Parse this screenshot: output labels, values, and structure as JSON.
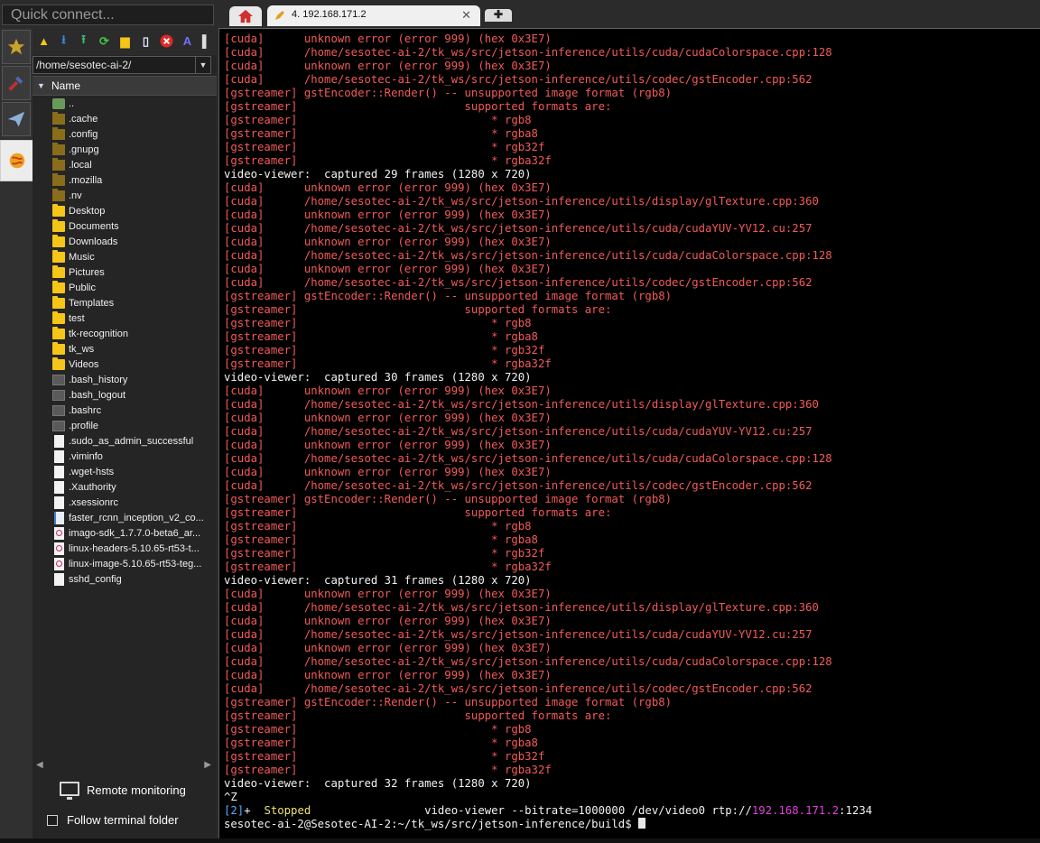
{
  "quick_connect": {
    "placeholder": "Quick connect..."
  },
  "tabs": {
    "home_icon": "home-icon",
    "session_label": "4. 192.168.171.2",
    "close_glyph": "✕",
    "new_tab_glyph": "✚"
  },
  "side_tabs": [
    "star-icon",
    "tools-icon",
    "send-icon",
    "sftp-icon"
  ],
  "file_panel": {
    "path": "/home/sesotec-ai-2/",
    "column_name": "Name",
    "items": [
      {
        "name": "..",
        "type": "up"
      },
      {
        "name": ".cache",
        "type": "hfolder"
      },
      {
        "name": ".config",
        "type": "hfolder"
      },
      {
        "name": ".gnupg",
        "type": "hfolder"
      },
      {
        "name": ".local",
        "type": "hfolder"
      },
      {
        "name": ".mozilla",
        "type": "hfolder"
      },
      {
        "name": ".nv",
        "type": "hfolder"
      },
      {
        "name": "Desktop",
        "type": "folder"
      },
      {
        "name": "Documents",
        "type": "folder"
      },
      {
        "name": "Downloads",
        "type": "folder"
      },
      {
        "name": "Music",
        "type": "folder"
      },
      {
        "name": "Pictures",
        "type": "folder"
      },
      {
        "name": "Public",
        "type": "folder"
      },
      {
        "name": "Templates",
        "type": "folder"
      },
      {
        "name": "test",
        "type": "folder"
      },
      {
        "name": "tk-recognition",
        "type": "folder"
      },
      {
        "name": "tk_ws",
        "type": "folder"
      },
      {
        "name": "Videos",
        "type": "folder"
      },
      {
        "name": ".bash_history",
        "type": "hfile"
      },
      {
        "name": ".bash_logout",
        "type": "hfile"
      },
      {
        "name": ".bashrc",
        "type": "hfile"
      },
      {
        "name": ".profile",
        "type": "hfile"
      },
      {
        "name": ".sudo_as_admin_successful",
        "type": "file"
      },
      {
        "name": ".viminfo",
        "type": "file"
      },
      {
        "name": ".wget-hsts",
        "type": "file"
      },
      {
        "name": ".Xauthority",
        "type": "file"
      },
      {
        "name": ".xsessionrc",
        "type": "file"
      },
      {
        "name": "faster_rcnn_inception_v2_co...",
        "type": "bfile"
      },
      {
        "name": "imago-sdk_1.7.7.0-beta6_ar...",
        "type": "pkg"
      },
      {
        "name": "linux-headers-5.10.65-rt53-t...",
        "type": "pkg"
      },
      {
        "name": "linux-image-5.10.65-rt53-teg...",
        "type": "pkg"
      },
      {
        "name": "sshd_config",
        "type": "file"
      }
    ],
    "remote_monitoring": "Remote monitoring",
    "follow_terminal": "Follow terminal folder"
  },
  "terminal": {
    "lines": [
      [
        [
          "r",
          "[cuda]      unknown error (error 999) (hex 0x3E7)"
        ]
      ],
      [
        [
          "r",
          "[cuda]      /home/sesotec-ai-2/tk_ws/src/jetson-inference/utils/cuda/cudaColorspace.cpp:128"
        ]
      ],
      [
        [
          "r",
          "[cuda]      unknown error (error 999) (hex 0x3E7)"
        ]
      ],
      [
        [
          "r",
          "[cuda]      /home/sesotec-ai-2/tk_ws/src/jetson-inference/utils/codec/gstEncoder.cpp:562"
        ]
      ],
      [
        [
          "r",
          "[gstreamer] gstEncoder::Render() -- unsupported image format (rgb8)"
        ]
      ],
      [
        [
          "r",
          "[gstreamer]                         supported formats are:"
        ]
      ],
      [
        [
          "r",
          "[gstreamer]                             * rgb8"
        ]
      ],
      [
        [
          "r",
          "[gstreamer]                             * rgba8"
        ]
      ],
      [
        [
          "r",
          "[gstreamer]                             * rgb32f"
        ]
      ],
      [
        [
          "r",
          "[gstreamer]                             * rgba32f"
        ]
      ],
      [
        [
          "w",
          "video-viewer:  captured 29 frames (1280 x 720)"
        ]
      ],
      [
        [
          "r",
          "[cuda]      unknown error (error 999) (hex 0x3E7)"
        ]
      ],
      [
        [
          "r",
          "[cuda]      /home/sesotec-ai-2/tk_ws/src/jetson-inference/utils/display/glTexture.cpp:360"
        ]
      ],
      [
        [
          "r",
          "[cuda]      unknown error (error 999) (hex 0x3E7)"
        ]
      ],
      [
        [
          "r",
          "[cuda]      /home/sesotec-ai-2/tk_ws/src/jetson-inference/utils/cuda/cudaYUV-YV12.cu:257"
        ]
      ],
      [
        [
          "r",
          "[cuda]      unknown error (error 999) (hex 0x3E7)"
        ]
      ],
      [
        [
          "r",
          "[cuda]      /home/sesotec-ai-2/tk_ws/src/jetson-inference/utils/cuda/cudaColorspace.cpp:128"
        ]
      ],
      [
        [
          "r",
          "[cuda]      unknown error (error 999) (hex 0x3E7)"
        ]
      ],
      [
        [
          "r",
          "[cuda]      /home/sesotec-ai-2/tk_ws/src/jetson-inference/utils/codec/gstEncoder.cpp:562"
        ]
      ],
      [
        [
          "r",
          "[gstreamer] gstEncoder::Render() -- unsupported image format (rgb8)"
        ]
      ],
      [
        [
          "r",
          "[gstreamer]                         supported formats are:"
        ]
      ],
      [
        [
          "r",
          "[gstreamer]                             * rgb8"
        ]
      ],
      [
        [
          "r",
          "[gstreamer]                             * rgba8"
        ]
      ],
      [
        [
          "r",
          "[gstreamer]                             * rgb32f"
        ]
      ],
      [
        [
          "r",
          "[gstreamer]                             * rgba32f"
        ]
      ],
      [
        [
          "w",
          "video-viewer:  captured 30 frames (1280 x 720)"
        ]
      ],
      [
        [
          "r",
          "[cuda]      unknown error (error 999) (hex 0x3E7)"
        ]
      ],
      [
        [
          "r",
          "[cuda]      /home/sesotec-ai-2/tk_ws/src/jetson-inference/utils/display/glTexture.cpp:360"
        ]
      ],
      [
        [
          "r",
          "[cuda]      unknown error (error 999) (hex 0x3E7)"
        ]
      ],
      [
        [
          "r",
          "[cuda]      /home/sesotec-ai-2/tk_ws/src/jetson-inference/utils/cuda/cudaYUV-YV12.cu:257"
        ]
      ],
      [
        [
          "r",
          "[cuda]      unknown error (error 999) (hex 0x3E7)"
        ]
      ],
      [
        [
          "r",
          "[cuda]      /home/sesotec-ai-2/tk_ws/src/jetson-inference/utils/cuda/cudaColorspace.cpp:128"
        ]
      ],
      [
        [
          "r",
          "[cuda]      unknown error (error 999) (hex 0x3E7)"
        ]
      ],
      [
        [
          "r",
          "[cuda]      /home/sesotec-ai-2/tk_ws/src/jetson-inference/utils/codec/gstEncoder.cpp:562"
        ]
      ],
      [
        [
          "r",
          "[gstreamer] gstEncoder::Render() -- unsupported image format (rgb8)"
        ]
      ],
      [
        [
          "r",
          "[gstreamer]                         supported formats are:"
        ]
      ],
      [
        [
          "r",
          "[gstreamer]                             * rgb8"
        ]
      ],
      [
        [
          "r",
          "[gstreamer]                             * rgba8"
        ]
      ],
      [
        [
          "r",
          "[gstreamer]                             * rgb32f"
        ]
      ],
      [
        [
          "r",
          "[gstreamer]                             * rgba32f"
        ]
      ],
      [
        [
          "w",
          "video-viewer:  captured 31 frames (1280 x 720)"
        ]
      ],
      [
        [
          "r",
          "[cuda]      unknown error (error 999) (hex 0x3E7)"
        ]
      ],
      [
        [
          "r",
          "[cuda]      /home/sesotec-ai-2/tk_ws/src/jetson-inference/utils/display/glTexture.cpp:360"
        ]
      ],
      [
        [
          "r",
          "[cuda]      unknown error (error 999) (hex 0x3E7)"
        ]
      ],
      [
        [
          "r",
          "[cuda]      /home/sesotec-ai-2/tk_ws/src/jetson-inference/utils/cuda/cudaYUV-YV12.cu:257"
        ]
      ],
      [
        [
          "r",
          "[cuda]      unknown error (error 999) (hex 0x3E7)"
        ]
      ],
      [
        [
          "r",
          "[cuda]      /home/sesotec-ai-2/tk_ws/src/jetson-inference/utils/cuda/cudaColorspace.cpp:128"
        ]
      ],
      [
        [
          "r",
          "[cuda]      unknown error (error 999) (hex 0x3E7)"
        ]
      ],
      [
        [
          "r",
          "[cuda]      /home/sesotec-ai-2/tk_ws/src/jetson-inference/utils/codec/gstEncoder.cpp:562"
        ]
      ],
      [
        [
          "r",
          "[gstreamer] gstEncoder::Render() -- unsupported image format (rgb8)"
        ]
      ],
      [
        [
          "r",
          "[gstreamer]                         supported formats are:"
        ]
      ],
      [
        [
          "r",
          "[gstreamer]                             * rgb8"
        ]
      ],
      [
        [
          "r",
          "[gstreamer]                             * rgba8"
        ]
      ],
      [
        [
          "r",
          "[gstreamer]                             * rgb32f"
        ]
      ],
      [
        [
          "r",
          "[gstreamer]                             * rgba32f"
        ]
      ],
      [
        [
          "w",
          "video-viewer:  captured 32 frames (1280 x 720)"
        ]
      ],
      [
        [
          "w",
          "^Z"
        ]
      ],
      [
        [
          "cy",
          "[2]"
        ],
        [
          "w",
          "+  "
        ],
        [
          "yl",
          "Stopped"
        ],
        [
          "w",
          "                 video-viewer --bitrate=1000000 /dev/video0 rtp://"
        ],
        [
          "mg",
          "192.168.171.2"
        ],
        [
          "w",
          ":1234"
        ]
      ],
      [
        [
          "w",
          "sesotec-ai-2@Sesotec-AI-2:~/tk_ws/src/jetson-inference/build$ "
        ]
      ]
    ]
  }
}
